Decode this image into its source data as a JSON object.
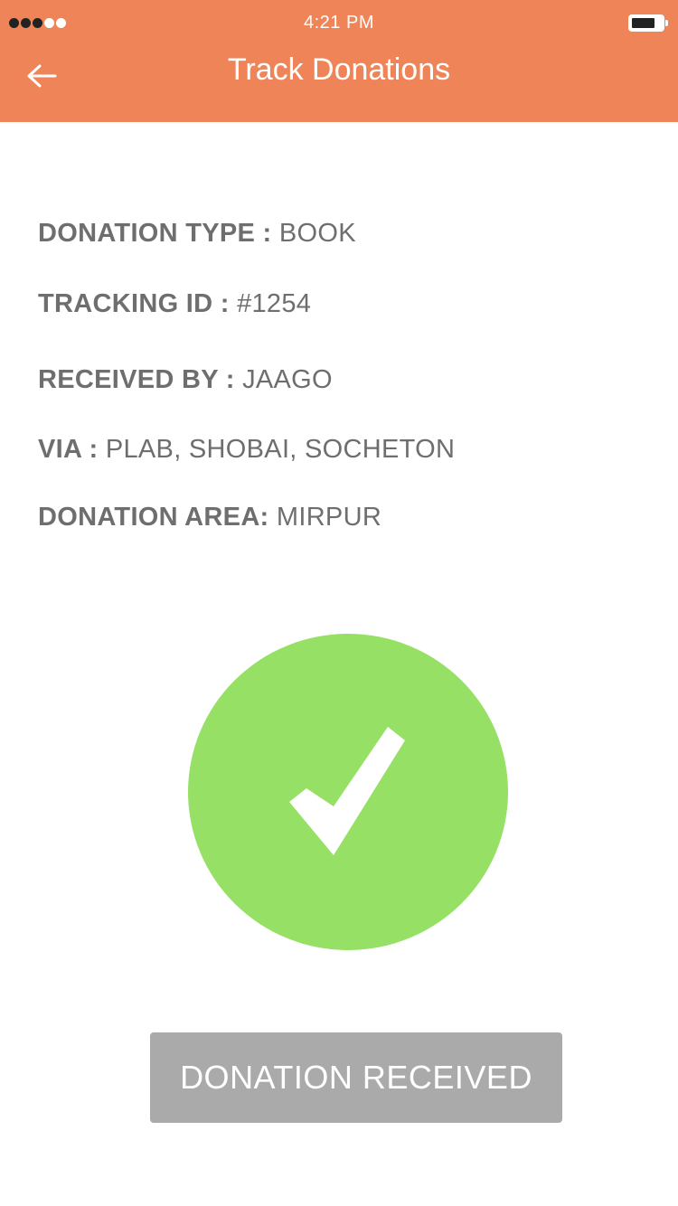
{
  "status_bar": {
    "time": "4:21 PM",
    "signal_bars_filled": 3,
    "signal_bars_total": 5,
    "battery_level": 0.75
  },
  "header": {
    "back_icon": "arrow-left-icon",
    "title": "Track Donations",
    "background_color": "#ee8457"
  },
  "details": {
    "donation_type_label": "DONATION TYPE :",
    "donation_type_value": "BOOK",
    "tracking_id_label": "TRACKING ID :",
    "tracking_id_value": "#1254",
    "received_by_label": "RECEIVED BY :",
    "received_by_value": "JAAGO",
    "via_label": "VIA :",
    "via_value": "PLAB, SHOBAI, SOCHETON",
    "donation_area_label": "DONATION AREA:",
    "donation_area_value": "MIRPUR"
  },
  "status_indicator": {
    "icon": "checkmark-icon",
    "color": "#95e065"
  },
  "action": {
    "received_label": "DONATION RECEIVED",
    "button_color": "#aaaaaa"
  }
}
